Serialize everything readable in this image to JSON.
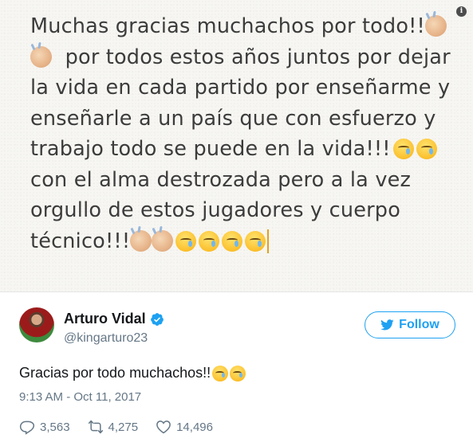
{
  "note": {
    "lines": [
      "Muchas gracias muchachos por todo!!",
      "por todos estos años juntos por dejar",
      "la vida en cada partido por enseñarme y",
      "enseñarle a un país que con esfuerzo y",
      "trabajo todo se puede en la vida!!!",
      "con el alma destrozada pero a la vez",
      "orgullo de estos jugadores y cuerpo",
      "técnico!!!"
    ]
  },
  "info_label": "i",
  "author": {
    "display_name": "Arturo Vidal",
    "handle": "@kingarturo23",
    "verified": true
  },
  "follow_button": {
    "label": "Follow"
  },
  "tweet": {
    "text": "Gracias por todo muchachos!!",
    "timestamp": "9:13 AM - Oct 11, 2017"
  },
  "actions": {
    "replies": "3,563",
    "retweets": "4,275",
    "likes": "14,496"
  },
  "colors": {
    "twitter_blue": "#1da1f2",
    "muted_text": "#657786",
    "note_background": "#f7f6f2"
  },
  "icons": [
    "info-icon",
    "verified-icon",
    "twitter-bird-icon",
    "reply-icon",
    "retweet-icon",
    "like-icon",
    "clapping-hands-emoji",
    "crying-face-emoji"
  ]
}
